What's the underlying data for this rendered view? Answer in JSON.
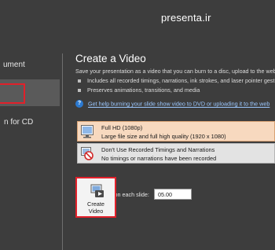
{
  "site": {
    "title": "presenta.ir"
  },
  "sidebar": {
    "items": [
      {
        "label": "ument"
      },
      {
        "label": ""
      },
      {
        "label": "n for CD"
      }
    ]
  },
  "main": {
    "heading": "Create a Video",
    "description": "Save your presentation as a video that you can burn to a disc, upload to the web",
    "bullets": [
      "Includes all recorded timings, narrations, ink strokes, and laser pointer gest",
      "Preserves animations, transitions, and media"
    ],
    "help_link": "Get help burning your slide show video to DVD or uploading it to the web",
    "quality": {
      "title": "Full HD (1080p)",
      "subtitle": "Large file size and full high quality (1920 x 1080)"
    },
    "timings": {
      "title": "Don't Use Recorded Timings and Narrations",
      "subtitle": "No timings or narrations have been recorded"
    },
    "seconds": {
      "label": "Seconds spent on each slide:",
      "value": "05.00"
    },
    "create_button": {
      "line1": "Create",
      "line2": "Video"
    }
  },
  "colors": {
    "accent_red": "#e2202a",
    "link_blue": "#9cc8ff",
    "background": "#3d3d3d"
  }
}
